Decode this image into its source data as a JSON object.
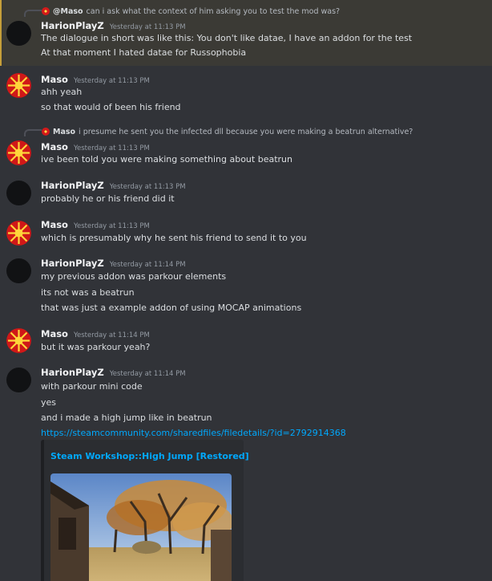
{
  "colors": {
    "background": "#313338",
    "highlight_background": "#3b3a35",
    "highlight_bar": "#c59e3a",
    "link": "#00a8fc",
    "text": "#dbdee1",
    "author": "#f2f3f5",
    "timestamp": "#949ba4"
  },
  "messages": [
    {
      "reply_author": "@Maso",
      "reply_text": "can i ask what the context of him asking you to test the mod was?",
      "author": "HarionPlayZ",
      "timestamp": "Yesterday at 11:13 PM",
      "lines": [
        "The dialogue in short was like this: You don't like datae, I have an addon for the test",
        "At that moment I hated datae for Russophobia"
      ]
    },
    {
      "author": "Maso",
      "timestamp": "Yesterday at 11:13 PM",
      "lines": [
        "ahh yeah",
        "so that would of been his friend"
      ]
    },
    {
      "reply_author": "Maso",
      "reply_text": "i presume he sent you the infected dll because you were making a beatrun alternative?",
      "author": "Maso",
      "timestamp": "Yesterday at 11:13 PM",
      "lines": [
        "ive been told you were making something about beatrun"
      ]
    },
    {
      "author": "HarionPlayZ",
      "timestamp": "Yesterday at 11:13 PM",
      "lines": [
        "probably he or his friend did it"
      ]
    },
    {
      "author": "Maso",
      "timestamp": "Yesterday at 11:13 PM",
      "lines": [
        "which is presumably why he sent his friend to send it to you"
      ]
    },
    {
      "author": "HarionPlayZ",
      "timestamp": "Yesterday at 11:14 PM",
      "lines": [
        "my previous addon was parkour elements",
        "its not was a beatrun",
        "that was just a example addon of using MOCAP animations"
      ]
    },
    {
      "author": "Maso",
      "timestamp": "Yesterday at 11:14 PM",
      "lines": [
        "but it was parkour yeah?"
      ]
    },
    {
      "author": "HarionPlayZ",
      "timestamp": "Yesterday at 11:14 PM",
      "lines": [
        "with parkour mini code",
        "yes",
        "and i made a high jump like in beatrun"
      ],
      "link": "https://steamcommunity.com/sharedfiles/filedetails/?id=2792914368",
      "embed_title": "Steam Workshop::High Jump [Restored]"
    }
  ]
}
